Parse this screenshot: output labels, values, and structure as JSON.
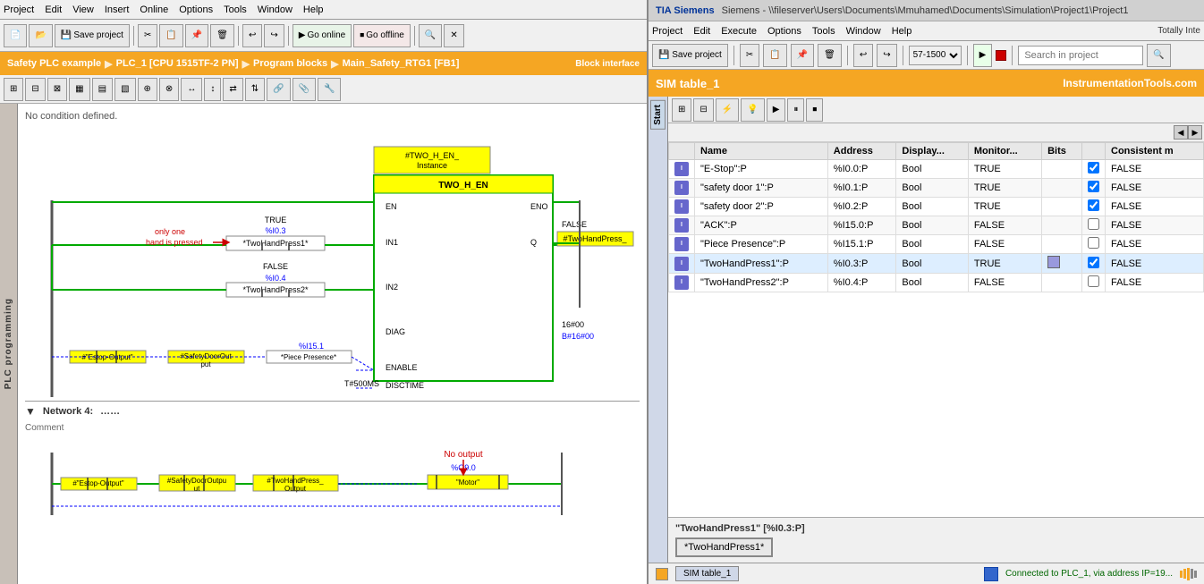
{
  "left_panel": {
    "menu": {
      "items": [
        "Project",
        "Edit",
        "View",
        "Insert",
        "Online",
        "Options",
        "Tools",
        "Window",
        "Help"
      ]
    },
    "toolbar": {
      "save_label": "Save project",
      "go_online_label": "Go online",
      "go_offline_label": "Go offline"
    },
    "breadcrumb": {
      "parts": [
        "Safety PLC example",
        "PLC_1 [CPU 1515TF-2 PN]",
        "Program blocks",
        "Main_Safety_RTG1 [FB1]"
      ]
    },
    "block_interface_label": "Block interface",
    "sidebar_label": "PLC programming",
    "no_condition": "No condition defined.",
    "network4": {
      "label": "Network 4:",
      "dots": "……",
      "comment": "Comment",
      "no_output": "No output"
    }
  },
  "diagram": {
    "fb_instance": "#TWO_H_EN_\nInstance",
    "fb_name": "TWO_H_EN",
    "pin_en": "EN",
    "pin_eno": "ENO",
    "pin_in1": "IN1",
    "pin_q": "Q",
    "pin_in2": "IN2",
    "pin_diag": "DIAG",
    "pin_enable": "ENABLE",
    "pin_disctime": "DISCTIME",
    "in1_contact": "*TwoHandPress1*",
    "in2_contact": "*TwoHandPress2*",
    "in1_addr": "%I0.3",
    "in1_val": "TRUE",
    "in2_addr": "%I0.4",
    "in2_val": "FALSE",
    "q_val": "FALSE",
    "q_contact": "#TwoHandPress_\nOutput",
    "diag_val": "16#00",
    "diag_addr": "B#16#00",
    "estop_label": "#\"Estop-Output\"",
    "safety_door": "#SafetyDoorOutput",
    "piece_presence_addr": "%I15.1",
    "piece_presence": "*Piece Presence*",
    "t500ms": "T#500MS",
    "only_one": "only one",
    "hand_pressed": "hand is pressed",
    "network4_estop": "#\"Estop-Output\"",
    "network4_door": "#SafetyDoorOutpu\nut",
    "network4_press_output": "#TwoHandPress_\nOutput",
    "network4_motor_addr": "%Q9.0",
    "network4_motor": "\"Motor\""
  },
  "right_panel": {
    "title": "Siemens - \\\\fileserver\\Users\\Documents\\Mmuhamed\\Documents\\Simulation\\Project1\\Project1",
    "menu": {
      "items": [
        "Project",
        "Edit",
        "Execute",
        "Options",
        "Tools",
        "Window",
        "Help"
      ]
    },
    "toolbar_right": "Totally Inte",
    "sim_title": "SIM table_1",
    "brand": "InstrumentationTools.com",
    "search_placeholder": "Search in project",
    "columns": [
      "",
      "Name",
      "Address",
      "Display...",
      "Monitor...",
      "Bits",
      "",
      "Consistent m"
    ],
    "rows": [
      {
        "icon": "io",
        "name": "\"E-Stop\":P",
        "address": "%I0.0:P",
        "display": "Bool",
        "monitor": "TRUE",
        "bits": "",
        "cb1": true,
        "consistent": "FALSE"
      },
      {
        "icon": "io",
        "name": "\"safety door 1\":P",
        "address": "%I0.1:P",
        "display": "Bool",
        "monitor": "TRUE",
        "bits": "",
        "cb1": true,
        "consistent": "FALSE"
      },
      {
        "icon": "io",
        "name": "\"safety door 2\":P",
        "address": "%I0.2:P",
        "display": "Bool",
        "monitor": "TRUE",
        "bits": "",
        "cb1": true,
        "consistent": "FALSE"
      },
      {
        "icon": "io",
        "name": "\"ACK\":P",
        "address": "%I15.0:P",
        "display": "Bool",
        "monitor": "FALSE",
        "bits": "",
        "cb1": false,
        "consistent": "FALSE"
      },
      {
        "icon": "io",
        "name": "\"Piece Presence\":P",
        "address": "%I15.1:P",
        "display": "Bool",
        "monitor": "FALSE",
        "bits": "",
        "cb1": false,
        "consistent": "FALSE"
      },
      {
        "icon": "io",
        "name": "\"TwoHandPress1\":P",
        "address": "%I0.3:P",
        "display": "Bool",
        "monitor": "TRUE",
        "bits": "has_icon",
        "cb1": true,
        "consistent": "FALSE",
        "highlighted": true
      },
      {
        "icon": "io",
        "name": "\"TwoHandPress2\":P",
        "address": "%I0.4:P",
        "display": "Bool",
        "monitor": "FALSE",
        "bits": "",
        "cb1": false,
        "consistent": "FALSE"
      }
    ],
    "selected_signal": "\"TwoHandPress1\" [%I0.3:P]",
    "selected_value_btn": "*TwoHandPress1*",
    "status_tab": "SIM table_1",
    "status_connected": "Connected to PLC_1, via address IP=19...",
    "plc_dropdown": "57-1500"
  }
}
